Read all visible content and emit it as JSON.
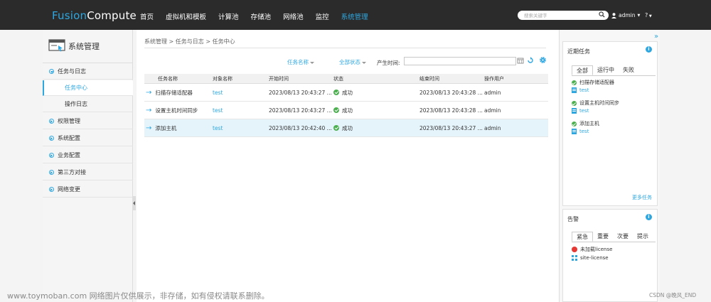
{
  "app": {
    "logo_prefix": "Fusion",
    "logo_suffix": "Compute"
  },
  "nav": {
    "items": [
      "首页",
      "虚拟机和模板",
      "计算池",
      "存储池",
      "网络池",
      "监控",
      "系统管理"
    ],
    "active": "系统管理"
  },
  "search": {
    "placeholder": "搜索关键字"
  },
  "user": {
    "name": "admin",
    "help": "?"
  },
  "sidebar": {
    "title": "系统管理",
    "groups": [
      "任务与日志",
      "权限管理",
      "系统配置",
      "业务配置",
      "第三方对接",
      "网络变更"
    ],
    "sub_items": [
      "任务中心",
      "操作日志"
    ]
  },
  "main": {
    "breadcrumb": "系统管理 > 任务与日志 > 任务中心",
    "filters": {
      "task_name": "任务名称",
      "status": "全部状态",
      "time_label": "产生时间:"
    },
    "table": {
      "columns": [
        "任务名称",
        "对象名称",
        "开始时间",
        "状态",
        "结束时间",
        "操作用户"
      ],
      "rows": [
        [
          "扫描存储适配器",
          "test",
          "2023/08/13 20:43:27 ...",
          "成功",
          "2023/08/13 20:43:28 ...",
          "admin"
        ],
        [
          "设置主机时间同步",
          "test",
          "2023/08/13 20:43:27 ...",
          "成功",
          "2023/08/13 20:43:28 ...",
          "admin"
        ],
        [
          "添加主机",
          "test",
          "2023/08/13 20:42:40 ...",
          "成功",
          "2023/08/13 20:43:27 ...",
          "admin"
        ]
      ]
    }
  },
  "recent_tasks": {
    "title": "近期任务",
    "tabs": [
      "全部",
      "运行中",
      "失败"
    ],
    "items": [
      {
        "name": "扫描存储适配器",
        "object": "test"
      },
      {
        "name": "设置主机时间同步",
        "object": "test"
      },
      {
        "name": "添加主机",
        "object": "test"
      }
    ],
    "more": "更多任务"
  },
  "alarms": {
    "title": "告警",
    "tabs": [
      "紧急",
      "重要",
      "次要",
      "提示"
    ],
    "items": [
      "未加载license",
      "site-license"
    ]
  },
  "footer": {
    "watermark": "www.toymoban.com 网络图片仅供展示，非存储，如有侵权请联系删除。",
    "csdn": "CSDN @晚风_END"
  },
  "colors": {
    "accent": "#2ea7e0",
    "topbar": "#2b2b2b",
    "success": "#4caf50",
    "danger": "#e53935",
    "selected_row": "#e5f4fb"
  }
}
